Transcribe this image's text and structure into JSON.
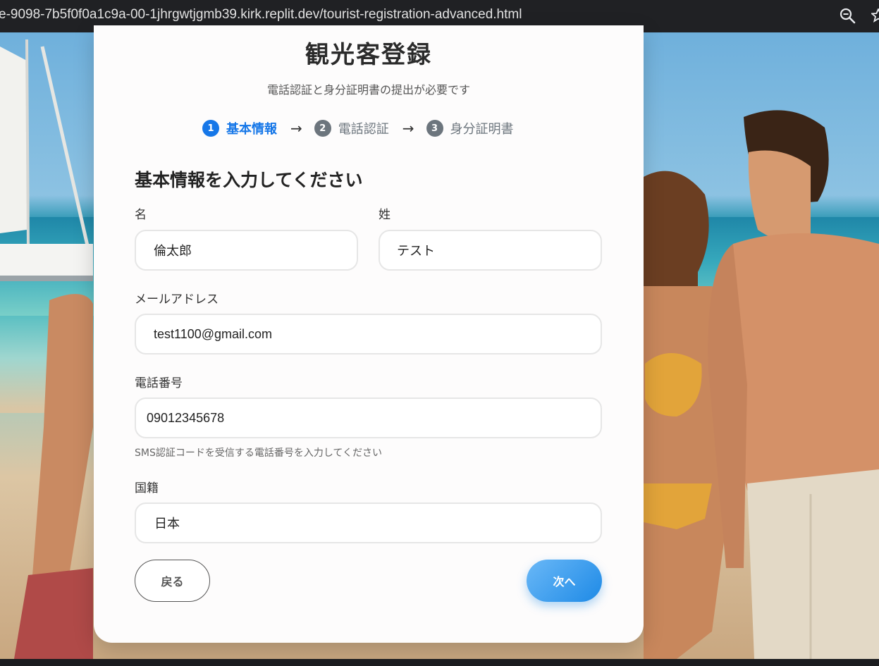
{
  "browser": {
    "url": "e-9098-7b5f0f0a1c9a-00-1jhrgwtjgmb39.kirk.replit.dev/tourist-registration-advanced.html",
    "zoom_icon": "zoom-icon",
    "bookmark_icon": "star-icon"
  },
  "card": {
    "title": "観光客登録",
    "subtitle": "電話認証と身分証明書の提出が必要です",
    "steps": [
      {
        "number": "1",
        "label": "基本情報",
        "state": "active"
      },
      {
        "number": "2",
        "label": "電話認証",
        "state": "pending"
      },
      {
        "number": "3",
        "label": "身分証明書",
        "state": "pending"
      }
    ],
    "step_arrow": "→",
    "section_heading": "基本情報を入力してください",
    "fields": {
      "first_name": {
        "label": "名",
        "value": "倫太郎"
      },
      "last_name": {
        "label": "姓",
        "value": "テスト"
      },
      "email": {
        "label": "メールアドレス",
        "value": "test1100@gmail.com"
      },
      "phone": {
        "label": "電話番号",
        "value": "09012345678",
        "hint": "SMS認証コードを受信する電話番号を入力してください"
      },
      "nationality": {
        "label": "国籍",
        "value": "日本"
      }
    },
    "buttons": {
      "back": "戻る",
      "next": "次へ"
    }
  },
  "colors": {
    "accent": "#1677e8",
    "step_pending": "#6c757d",
    "next_button_start": "#6ab8f7",
    "next_button_end": "#1e8ae6"
  }
}
